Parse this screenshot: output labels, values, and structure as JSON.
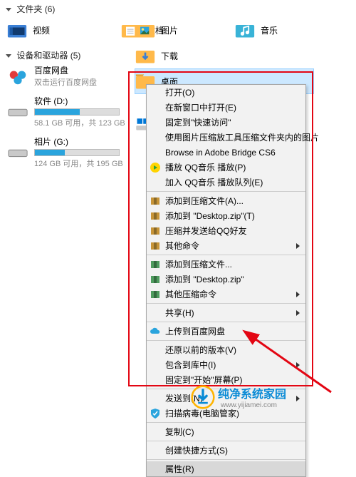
{
  "sections": {
    "folders_title": "文件夹",
    "folders_count": "(6)",
    "drives_title": "设备和驱动器",
    "drives_count": "(5)"
  },
  "folders": {
    "video": "视频",
    "pictures": "图片",
    "documents": "文档",
    "downloads": "下载",
    "music": "音乐",
    "desktop": "桌面"
  },
  "drives": {
    "baidu_title": "百度网盘",
    "baidu_sub": "双击运行百度网盘",
    "d_title": "软件 (D:)",
    "d_sub": "58.1 GB 可用，共 123 GB",
    "g_title": "相片 (G:)",
    "g_sub": "124 GB 可用，共 195 GB"
  },
  "ctx": {
    "open": "打开(O)",
    "open_new": "在新窗口中打开(E)",
    "pin_quick": "固定到\"快速访问\"",
    "compress_img": "使用图片压缩放工具压缩文件夹内的图片",
    "bridge": "Browse in Adobe Bridge CS6",
    "qqmusic_play": "播放 QQ音乐 播放(P)",
    "qqmusic_add": "加入 QQ音乐 播放队列(E)",
    "add_arc": "添加到压缩文件(A)...",
    "add_desk": "添加到 \"Desktop.zip\"(T)",
    "zip_qq": "压缩并发送给QQ好友",
    "other_cmd": "其他命令",
    "add_arc2": "添加到压缩文件...",
    "add_desk2": "添加到 \"Desktop.zip\"",
    "other_zip": "其他压缩命令",
    "share": "共享(H)",
    "upload_baidu": "上传到百度网盘",
    "restore_prev": "还原以前的版本(V)",
    "inc_lib": "包含到库中(I)",
    "pin_start": "固定到\"开始\"屏幕(P)",
    "send_to": "发送到(N)",
    "scan_virus": "扫描病毒(电脑管家)",
    "copy": "复制(C)",
    "shortcut": "创建快捷方式(S)",
    "properties": "属性(R)"
  },
  "wm": {
    "text": "纯净系统家园",
    "url": "www.yijiamei.com"
  }
}
